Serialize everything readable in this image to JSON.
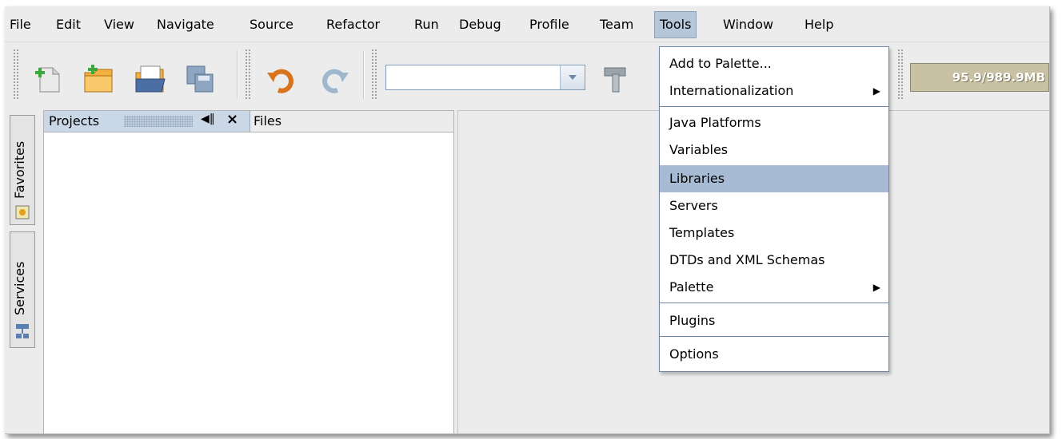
{
  "menubar": {
    "items": [
      {
        "label": "File"
      },
      {
        "label": "Edit"
      },
      {
        "label": "View"
      },
      {
        "label": "Navigate"
      },
      {
        "label": "Source"
      },
      {
        "label": "Refactor"
      },
      {
        "label": "Run"
      },
      {
        "label": "Debug"
      },
      {
        "label": "Profile"
      },
      {
        "label": "Team"
      },
      {
        "label": "Tools"
      },
      {
        "label": "Window"
      },
      {
        "label": "Help"
      }
    ],
    "active": "Tools"
  },
  "toolbar": {
    "icons": [
      "new-file-icon",
      "new-project-icon",
      "open-project-icon",
      "save-all-icon",
      "undo-icon",
      "redo-icon",
      "build-icon"
    ],
    "config_combo_value": "",
    "memory_label": "95.9/989.9MB"
  },
  "sidebar": {
    "tabs": [
      {
        "label": "Favorites",
        "icon": "favorites-icon"
      },
      {
        "label": "Services",
        "icon": "services-icon"
      }
    ]
  },
  "panel": {
    "tabs": [
      {
        "label": "Projects"
      },
      {
        "label": "Files"
      }
    ],
    "close_glyph": "×",
    "minimize_glyph": "◀‖"
  },
  "tools_menu": {
    "items": [
      {
        "label": "Add to Palette...",
        "submenu": false
      },
      {
        "label": "Internationalization",
        "submenu": true
      },
      {
        "label": "Java Platforms",
        "submenu": false
      },
      {
        "label": "Variables",
        "submenu": false
      },
      {
        "label": "Libraries",
        "submenu": false,
        "selected": true
      },
      {
        "label": "Servers",
        "submenu": false
      },
      {
        "label": "Templates",
        "submenu": false
      },
      {
        "label": "DTDs and XML Schemas",
        "submenu": false
      },
      {
        "label": "Palette",
        "submenu": true
      },
      {
        "label": "Plugins",
        "submenu": false
      },
      {
        "label": "Options",
        "submenu": false
      }
    ],
    "submenu_arrow": "▶"
  },
  "colors": {
    "menu_highlight": "#b6c6d9",
    "item_selected": "#a7bbd4",
    "memory_bg": "#c9c1a3"
  }
}
